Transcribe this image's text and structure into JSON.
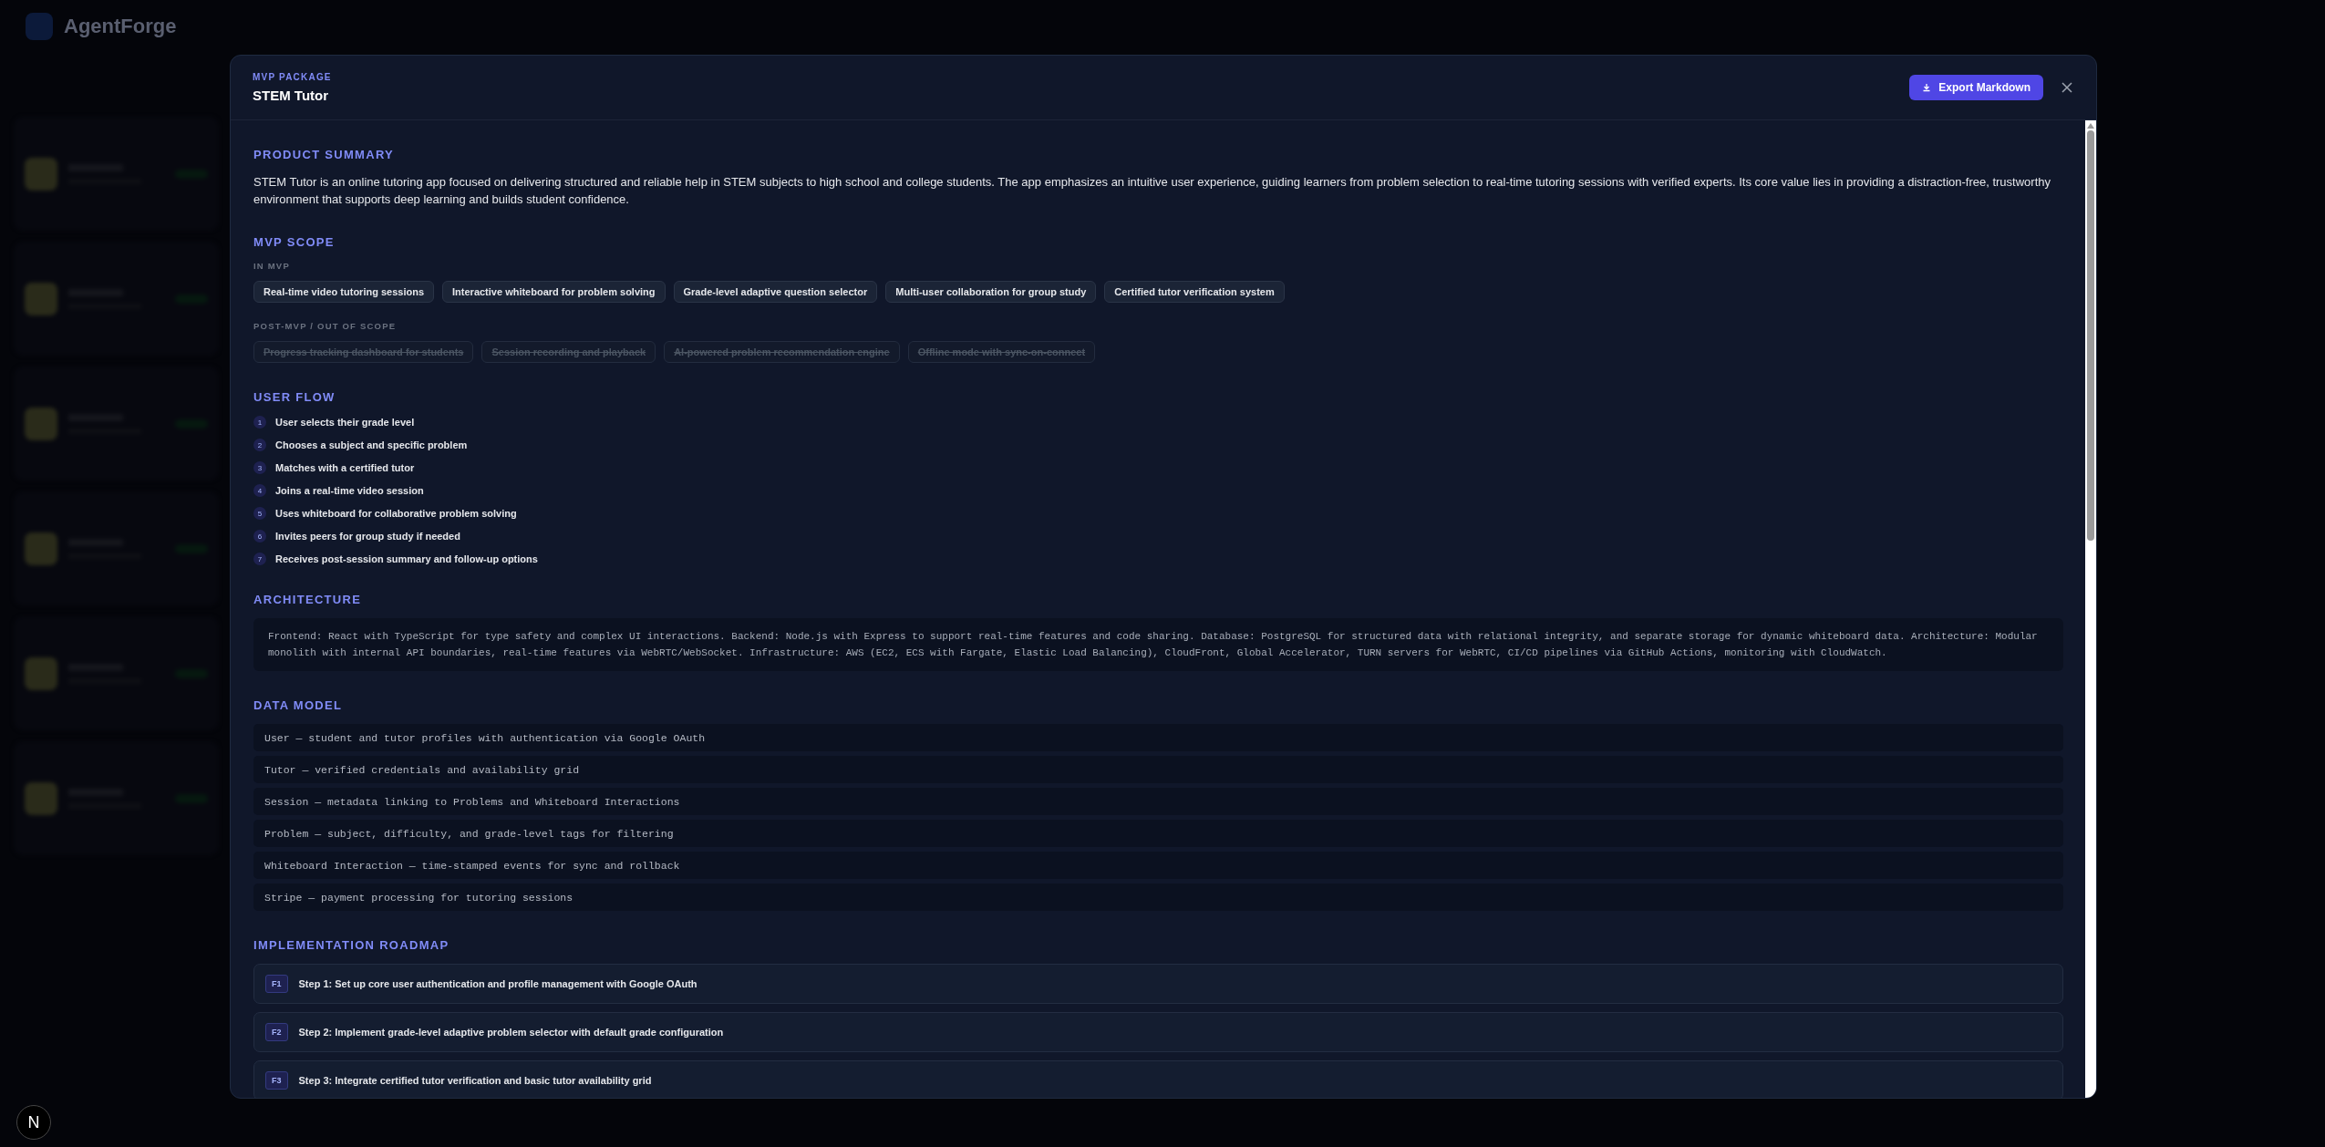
{
  "backdrop": {
    "logo": "AgentForge",
    "dev_badge": "N"
  },
  "modal": {
    "eyebrow": "MVP PACKAGE",
    "title": "STEM Tutor",
    "export_button": "Export Markdown",
    "sections": [
      {
        "kind": "text",
        "heading": "PRODUCT SUMMARY",
        "body": "STEM Tutor is an online tutoring app focused on delivering structured and reliable help in STEM subjects to high school and college students. The app emphasizes an intuitive user experience, guiding learners from problem selection to real-time tutoring sessions with verified experts. Its core value lies in providing a distraction-free, trustworthy environment that supports deep learning and builds student confidence."
      },
      {
        "kind": "scope",
        "heading": "MVP SCOPE",
        "groups": [
          {
            "label": "IN MVP",
            "deferred": false,
            "items": [
              "Real-time video tutoring sessions",
              "Interactive whiteboard for problem solving",
              "Grade-level adaptive question selector",
              "Multi-user collaboration for group study",
              "Certified tutor verification system"
            ]
          },
          {
            "label": "POST-MVP / OUT OF SCOPE",
            "deferred": true,
            "items": [
              "Progress tracking dashboard for students",
              "Session recording and playback",
              "AI-powered problem recommendation engine",
              "Offline mode with sync-on-connect"
            ]
          }
        ]
      },
      {
        "kind": "flow",
        "heading": "USER FLOW",
        "steps": [
          {
            "number": "1",
            "text": "User selects their grade level"
          },
          {
            "number": "2",
            "text": "Chooses a subject and specific problem"
          },
          {
            "number": "3",
            "text": "Matches with a certified tutor"
          },
          {
            "number": "4",
            "text": "Joins a real-time video session"
          },
          {
            "number": "5",
            "text": "Uses whiteboard for collaborative problem solving"
          },
          {
            "number": "6",
            "text": "Invites peers for group study if needed"
          },
          {
            "number": "7",
            "text": "Receives post-session summary and follow-up options"
          }
        ]
      },
      {
        "kind": "code",
        "heading": "ARCHITECTURE",
        "body": "Frontend: React with TypeScript for type safety and complex UI interactions. Backend: Node.js with Express to support real-time features and code sharing. Database: PostgreSQL for structured data with relational integrity, and separate storage for dynamic whiteboard data. Architecture: Modular monolith with internal API boundaries, real-time features via WebRTC/WebSocket. Infrastructure: AWS (EC2, ECS with Fargate, Elastic Load Balancing), CloudFront, Global Accelerator, TURN servers for WebRTC, CI/CD pipelines via GitHub Actions, monitoring with CloudWatch."
      },
      {
        "kind": "rows",
        "heading": "DATA MODEL",
        "rows": [
          "User — student and tutor profiles with authentication via Google OAuth",
          "Tutor — verified credentials and availability grid",
          "Session — metadata linking to Problems and Whiteboard Interactions",
          "Problem — subject, difficulty, and grade-level tags for filtering",
          "Whiteboard Interaction — time-stamped events for sync and rollback",
          "Stripe — payment processing for tutoring sessions"
        ]
      },
      {
        "kind": "roadmap",
        "heading": "IMPLEMENTATION ROADMAP",
        "steps": [
          {
            "badge": "F1",
            "text": "Step 1: Set up core user authentication and profile management with Google OAuth"
          },
          {
            "badge": "F2",
            "text": "Step 2: Implement grade-level adaptive problem selector with default grade configuration"
          },
          {
            "badge": "F3",
            "text": "Step 3: Integrate certified tutor verification and basic tutor availability grid"
          }
        ]
      }
    ]
  }
}
